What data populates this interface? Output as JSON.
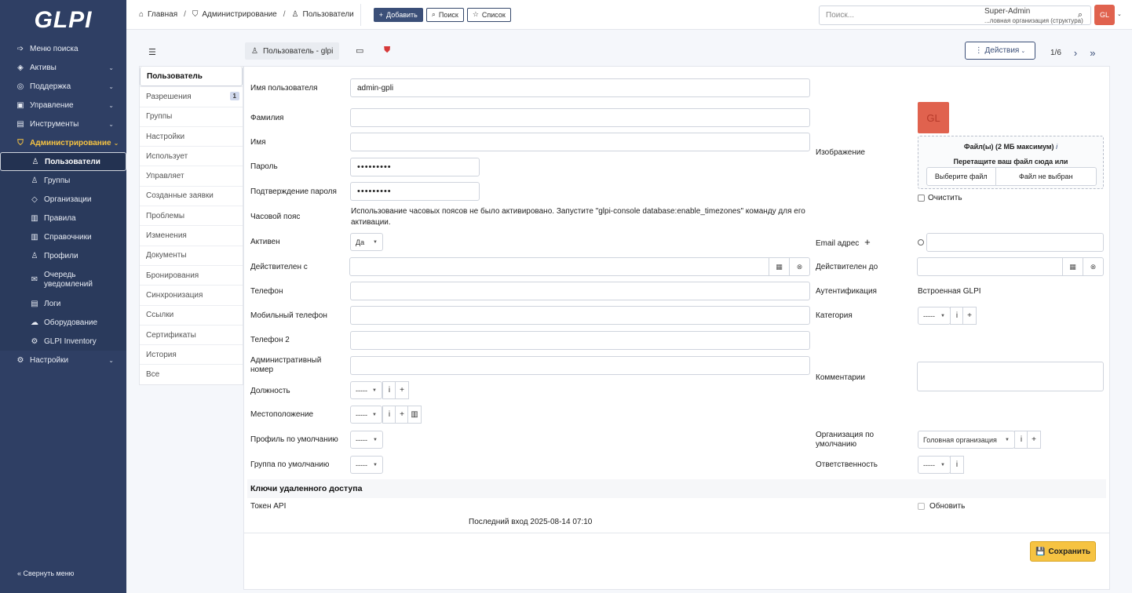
{
  "sidebar": {
    "logo": "GLPI",
    "items": [
      {
        "label": "Меню поиска",
        "icon": "arrow-right-icon",
        "chev": false
      },
      {
        "label": "Активы",
        "icon": "box-icon",
        "chev": true
      },
      {
        "label": "Поддержка",
        "icon": "headset-icon",
        "chev": true
      },
      {
        "label": "Управление",
        "icon": "wallet-icon",
        "chev": true
      },
      {
        "label": "Инструменты",
        "icon": "briefcase-icon",
        "chev": true
      },
      {
        "label": "Администрирование",
        "icon": "shield-icon",
        "chev": true
      }
    ],
    "subitems": [
      {
        "label": "Пользователи",
        "icon": "user-icon"
      },
      {
        "label": "Группы",
        "icon": "users-icon"
      },
      {
        "label": "Организации",
        "icon": "stack-icon"
      },
      {
        "label": "Правила",
        "icon": "book-icon"
      },
      {
        "label": "Справочники",
        "icon": "book-open-icon"
      },
      {
        "label": "Профили",
        "icon": "user-check-icon"
      },
      {
        "label": "Очередь уведомлений",
        "icon": "mail-forward-icon"
      },
      {
        "label": "Логи",
        "icon": "log-icon"
      },
      {
        "label": "Оборудование",
        "icon": "cloud-icon"
      },
      {
        "label": "GLPI Inventory",
        "icon": "gear-icon"
      }
    ],
    "settings": "Настройки",
    "collapse": "Свернуть меню"
  },
  "topbar": {
    "breadcrumb": [
      "Главная",
      "Администрирование",
      "Пользователи"
    ],
    "add": "Добавить",
    "search_btn": "Поиск",
    "list_btn": "Список",
    "search_placeholder": "Поиск...",
    "user_name": "Super-Admin",
    "user_org": "...ловная организация (структура)",
    "avatar": "GL"
  },
  "tabs": {
    "title": "Пользователь - glpi",
    "actions": "Действия",
    "pager": "1/6"
  },
  "leftnav": [
    {
      "label": "Пользователь"
    },
    {
      "label": "Разрешения",
      "badge": "1"
    },
    {
      "label": "Группы"
    },
    {
      "label": "Настройки"
    },
    {
      "label": "Использует"
    },
    {
      "label": "Управляет"
    },
    {
      "label": "Созданные заявки"
    },
    {
      "label": "Проблемы"
    },
    {
      "label": "Изменения"
    },
    {
      "label": "Документы"
    },
    {
      "label": "Бронирования"
    },
    {
      "label": "Синхронизация"
    },
    {
      "label": "Ссылки"
    },
    {
      "label": "Сертификаты"
    },
    {
      "label": "История"
    },
    {
      "label": "Все"
    }
  ],
  "form": {
    "username_label": "Имя пользователя",
    "username_value": "admin-gpli",
    "lastname_label": "Фамилия",
    "firstname_label": "Имя",
    "password_label": "Пароль",
    "password_value": "•••••••••",
    "password_confirm_label": "Подтверждение пароля",
    "password_confirm_value": "•••••••••",
    "timezone_label": "Часовой пояс",
    "timezone_note": "Использование часовых поясов не было активировано. Запустите \"glpi-console database:enable_timezones\" команду для его активации.",
    "active_label": "Активен",
    "active_value": "Да",
    "valid_from_label": "Действителен с",
    "phone_label": "Телефон",
    "mobile_label": "Мобильный телефон",
    "phone2_label": "Телефон 2",
    "admin_number_label": "Административный номер",
    "title_label": "Должность",
    "location_label": "Местоположение",
    "default_profile_label": "Профиль по умолчанию",
    "default_group_label": "Группа по умолчанию",
    "empty_select": "-----",
    "image_label": "Изображение",
    "avatar": "GL",
    "files_max": "Файл(ы) (2 МБ максимум)",
    "drop_text": "Перетащите ваш файл сюда или",
    "choose_file": "Выберите файл",
    "no_file": "Файл не выбран",
    "clear": "Очистить",
    "email_label": "Email адрес",
    "valid_until_label": "Действителен до",
    "auth_label": "Аутентификация",
    "auth_value": "Встроенная GLPI",
    "category_label": "Категория",
    "comments_label": "Комментарии",
    "default_entity_label": "Организация по умолчанию",
    "default_entity_value": "Головная организация",
    "responsible_label": "Ответственность",
    "remote_keys_title": "Ключи удаленного доступа",
    "api_token_label": "Токен API",
    "refresh_label": "Обновить",
    "last_login": "Последний вход 2025-08-14 07:10",
    "save": "Сохранить"
  }
}
